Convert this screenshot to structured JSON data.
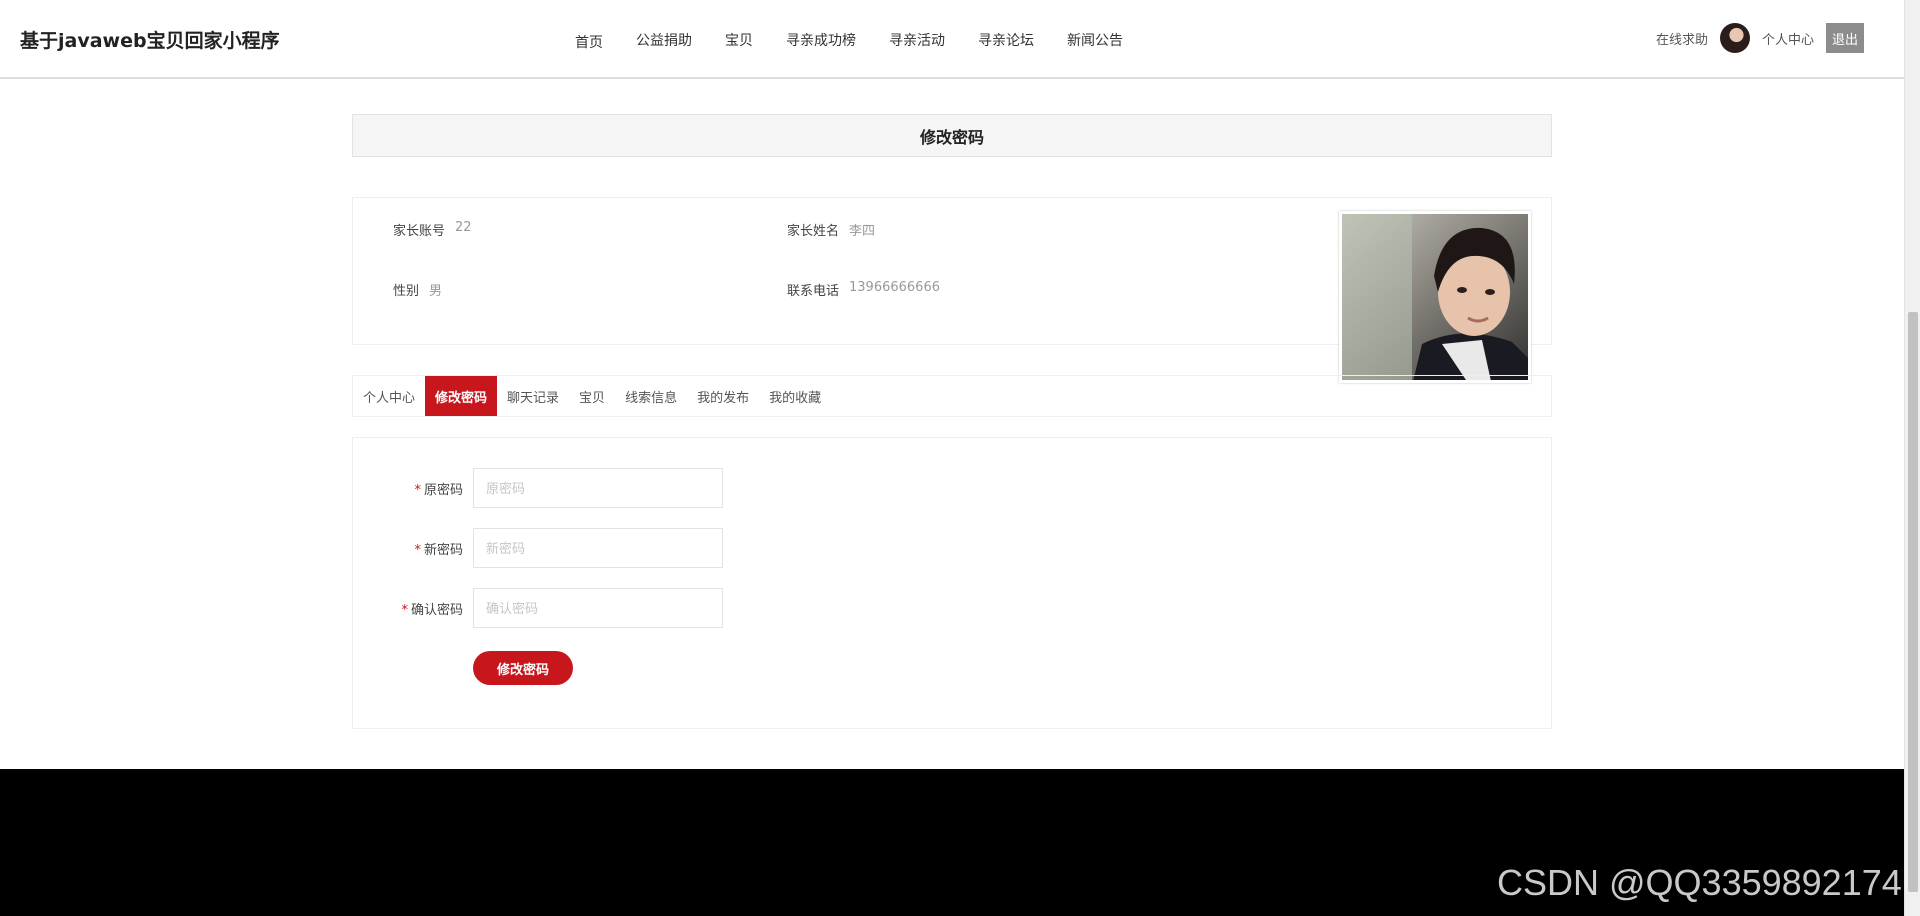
{
  "header": {
    "brand": "基于javaweb宝贝回家小程序",
    "nav": [
      "首页",
      "公益捐助",
      "宝贝",
      "寻亲成功榜",
      "寻亲活动",
      "寻亲论坛",
      "新闻公告"
    ],
    "online_help": "在线求助",
    "profile": "个人中心",
    "logout": "退出"
  },
  "page_title": "修改密码",
  "info": {
    "account_label": "家长账号",
    "account_value": "22",
    "name_label": "家长姓名",
    "name_value": "李四",
    "gender_label": "性别",
    "gender_value": "男",
    "phone_label": "联系电话",
    "phone_value": "13966666666"
  },
  "tabs": [
    "个人中心",
    "修改密码",
    "聊天记录",
    "宝贝",
    "线索信息",
    "我的发布",
    "我的收藏"
  ],
  "active_tab": "修改密码",
  "form": {
    "required_mark": "*",
    "old_label": "原密码",
    "old_placeholder": "原密码",
    "new_label": "新密码",
    "new_placeholder": "新密码",
    "confirm_label": "确认密码",
    "confirm_placeholder": "确认密码",
    "submit": "修改密码"
  },
  "watermark": "CSDN @QQ3359892174",
  "colors": {
    "accent": "#c8161d",
    "footer": "#000000",
    "logout_bg": "#8c8c8c"
  }
}
